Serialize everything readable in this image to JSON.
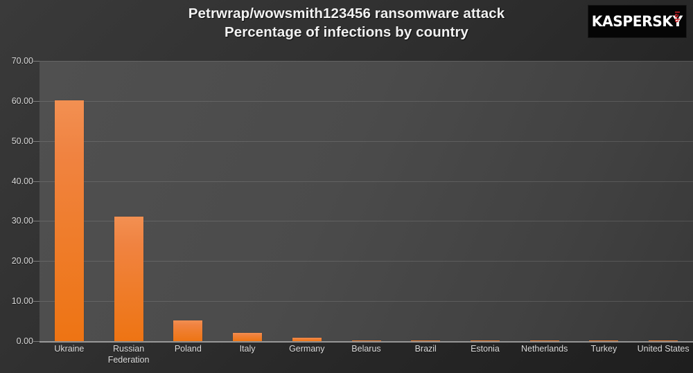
{
  "title": {
    "line1": "Petrwrap/wowsmith123456 ransomware attack",
    "line2": "Percentage of infections by country"
  },
  "logo": {
    "wordmark": "KASPERSKY",
    "sub": "lab"
  },
  "colors": {
    "bar_top": "#f29052",
    "bar_bottom": "#ee7413",
    "plot_background": "#4a4a4a",
    "page_background": "#2a2a2a",
    "text": "#dcdcdc",
    "logo_red": "#cc2127"
  },
  "chart_data": {
    "type": "bar",
    "title": "Petrwrap/wowsmith123456 ransomware attack\nPercentage of infections by country",
    "xlabel": "",
    "ylabel": "",
    "ylim": [
      0,
      70
    ],
    "yticks": [
      0,
      10,
      20,
      30,
      40,
      50,
      60,
      70
    ],
    "ytick_labels": [
      "0.00",
      "10.00",
      "20.00",
      "30.00",
      "40.00",
      "50.00",
      "60.00",
      "70.00"
    ],
    "grid": true,
    "legend": false,
    "categories": [
      "Ukraine",
      "Russian Federation",
      "Poland",
      "Italy",
      "Germany",
      "Belarus",
      "Brazil",
      "Estonia",
      "Netherlands",
      "Turkey",
      "United States"
    ],
    "values": [
      60.2,
      31.1,
      5.2,
      2.1,
      0.8,
      0.1,
      0.1,
      0.1,
      0.1,
      0.1,
      0.1
    ]
  }
}
